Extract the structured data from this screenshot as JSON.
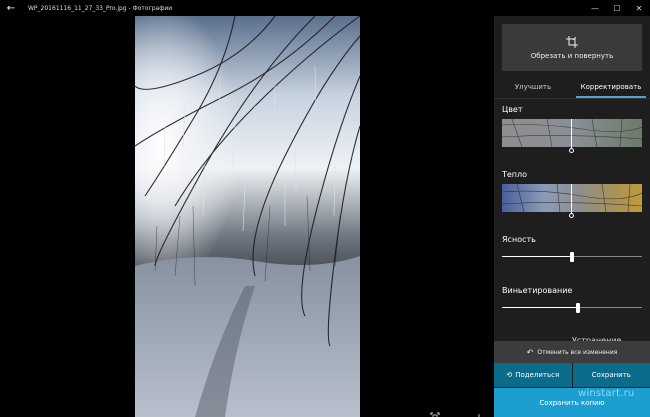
{
  "window": {
    "title": "WP_20161116_11_27_33_Pro.jpg - Фотографии",
    "back_icon": "back-arrow-icon",
    "minimize_glyph": "—",
    "maximize_glyph": "☐",
    "close_glyph": "✕"
  },
  "viewer": {
    "fit_icon": "fit-to-screen-icon",
    "zoom_out_glyph": "−",
    "zoom_in_glyph": "+"
  },
  "panel": {
    "crop_button": {
      "icon": "crop-icon",
      "label": "Обрезать и повернуть"
    },
    "tabs": [
      {
        "label": "Улучшить",
        "active": false
      },
      {
        "label": "Корректировать",
        "active": true
      }
    ],
    "color": {
      "label": "Цвет",
      "value": 0.5
    },
    "warmth": {
      "label": "Тепло",
      "value": 0.5
    },
    "clarity": {
      "label": "Ясность",
      "value": 0.5
    },
    "vignette": {
      "label": "Виньетирование",
      "value": 0.54
    },
    "next_section_label": "Устранение",
    "undo": {
      "icon": "undo-icon",
      "label": "Отменить все изменения"
    },
    "share": {
      "icon": "share-icon",
      "label": "Поделиться"
    },
    "save": {
      "label": "Сохранить"
    },
    "save_copy": {
      "label": "Сохранить копию"
    }
  },
  "watermark": "winstart.ru",
  "colors": {
    "accent": "#1b9fd1",
    "action_button": "#0a6b8a",
    "panel_bg": "#1e1e1e"
  }
}
